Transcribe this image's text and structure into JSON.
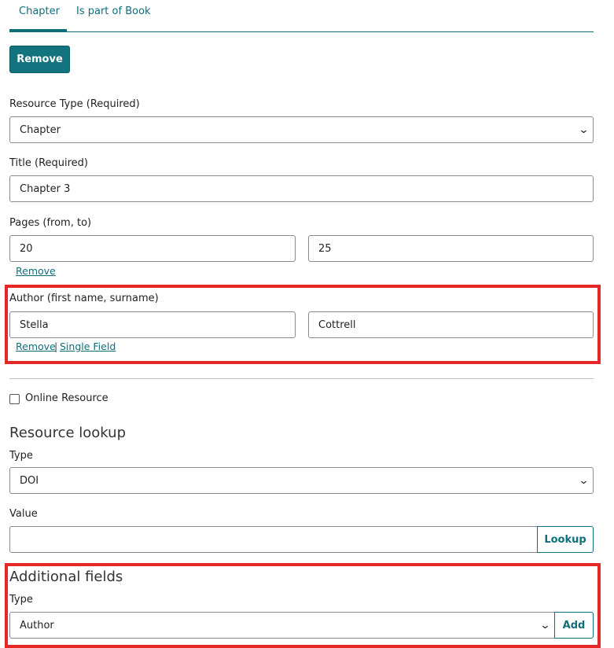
{
  "tabs": [
    {
      "label": "Chapter",
      "active": true
    },
    {
      "label": "Is part of Book",
      "active": false
    }
  ],
  "remove_button": "Remove",
  "resource_type": {
    "label": "Resource Type (Required)",
    "value": "Chapter"
  },
  "title": {
    "label": "Title (Required)",
    "value": "Chapter 3"
  },
  "pages": {
    "label": "Pages (from, to)",
    "from": "20",
    "to": "25",
    "remove_link": "Remove"
  },
  "author": {
    "label": "Author (first name, surname)",
    "first_name": "Stella",
    "surname": "Cottrell",
    "remove_link": "Remove",
    "separator": "|",
    "single_field_link": "Single Field"
  },
  "online_resource": {
    "label": "Online Resource",
    "checked": false
  },
  "resource_lookup": {
    "heading": "Resource lookup",
    "type_label": "Type",
    "type_value": "DOI",
    "value_label": "Value",
    "value": "",
    "lookup_button": "Lookup"
  },
  "additional_fields": {
    "heading": "Additional fields",
    "type_label": "Type",
    "type_value": "Author",
    "add_button": "Add"
  },
  "colors": {
    "accent": "#13737e",
    "highlight": "#e52727"
  }
}
